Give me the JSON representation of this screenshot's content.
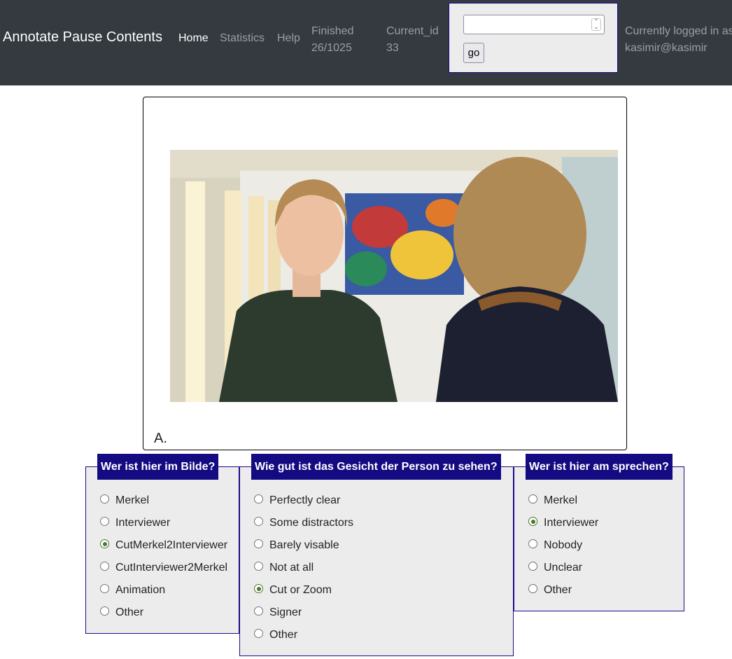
{
  "navbar": {
    "brand": "Annotate Pause Contents",
    "links": [
      "Home",
      "Statistics",
      "Help"
    ],
    "finished": {
      "label": "Finished",
      "value": "26/1025"
    },
    "current_id": {
      "label": "Current_id",
      "value": "33"
    },
    "id_form": {
      "input_value": "",
      "go_label": "go"
    },
    "login": {
      "line1": "Currently logged in as",
      "line2": "kasimir@kasimir"
    }
  },
  "video": {
    "label": "A."
  },
  "questions": [
    {
      "title": "Wer ist hier im Bilde?",
      "options": [
        "Merkel",
        "Interviewer",
        "CutMerkel2Interviewer",
        "CutInterviewer2Merkel",
        "Animation",
        "Other"
      ],
      "selected": "CutMerkel2Interviewer"
    },
    {
      "title": "Wie gut ist das Gesicht der Person zu sehen?",
      "options": [
        "Perfectly clear",
        "Some distractors",
        "Barely visable",
        "Not at all",
        "Cut or Zoom",
        "Signer",
        "Other"
      ],
      "selected": "Cut or Zoom"
    },
    {
      "title": "Wer ist hier am sprechen?",
      "options": [
        "Merkel",
        "Interviewer",
        "Nobody",
        "Unclear",
        "Other"
      ],
      "selected": "Interviewer"
    }
  ],
  "colors": {
    "navbar_bg": "#343a40",
    "panel_title_bg": "#140a82",
    "panel_border": "#1a0a8c",
    "panel_bg": "#ececec",
    "radio_checked": "#4a7a2c"
  }
}
